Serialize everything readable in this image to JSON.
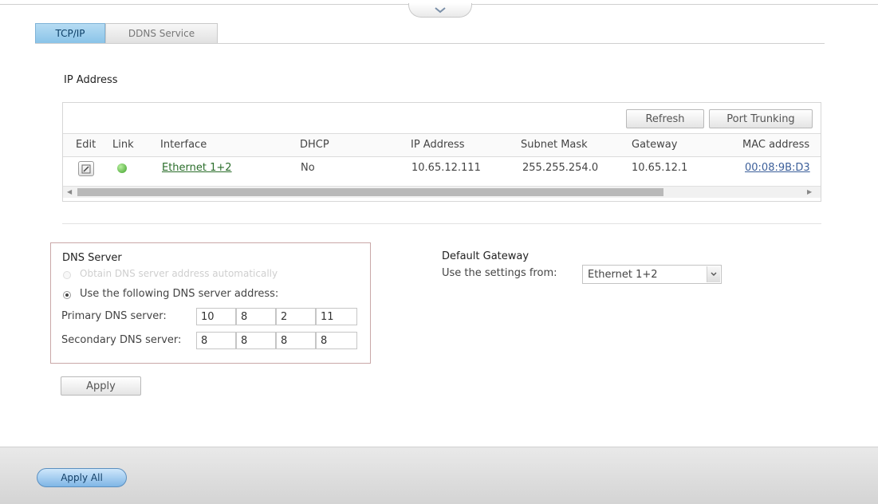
{
  "tabs": [
    {
      "label": "TCP/IP",
      "active": true
    },
    {
      "label": "DDNS Service",
      "active": false
    }
  ],
  "ip_section": {
    "title": "IP Address",
    "buttons": {
      "refresh": "Refresh",
      "port_trunking": "Port Trunking"
    },
    "columns": [
      "Edit",
      "Link",
      "Interface",
      "DHCP",
      "IP Address",
      "Subnet Mask",
      "Gateway",
      "MAC address"
    ],
    "rows": [
      {
        "interface": "Ethernet 1+2",
        "dhcp": "No",
        "ip_address": "10.65.12.111",
        "subnet_mask": "255.255.254.0",
        "gateway": "10.65.12.1",
        "mac_address": "00:08:9B:D3"
      }
    ]
  },
  "dns": {
    "title": "DNS Server",
    "auto_option": "Obtain DNS server address automatically",
    "manual_option": "Use the following DNS server address:",
    "primary_label": "Primary DNS server:",
    "secondary_label": "Secondary DNS server:",
    "primary": [
      "10",
      "8",
      "2",
      "11"
    ],
    "secondary": [
      "8",
      "8",
      "8",
      "8"
    ],
    "apply_label": "Apply"
  },
  "default_gateway": {
    "title": "Default Gateway",
    "label": "Use the settings from:",
    "selected": "Ethernet 1+2"
  },
  "footer": {
    "apply_all_label": "Apply All"
  },
  "colors": {
    "accent": "#8ac4e8",
    "link_status": "#3fa02a"
  }
}
